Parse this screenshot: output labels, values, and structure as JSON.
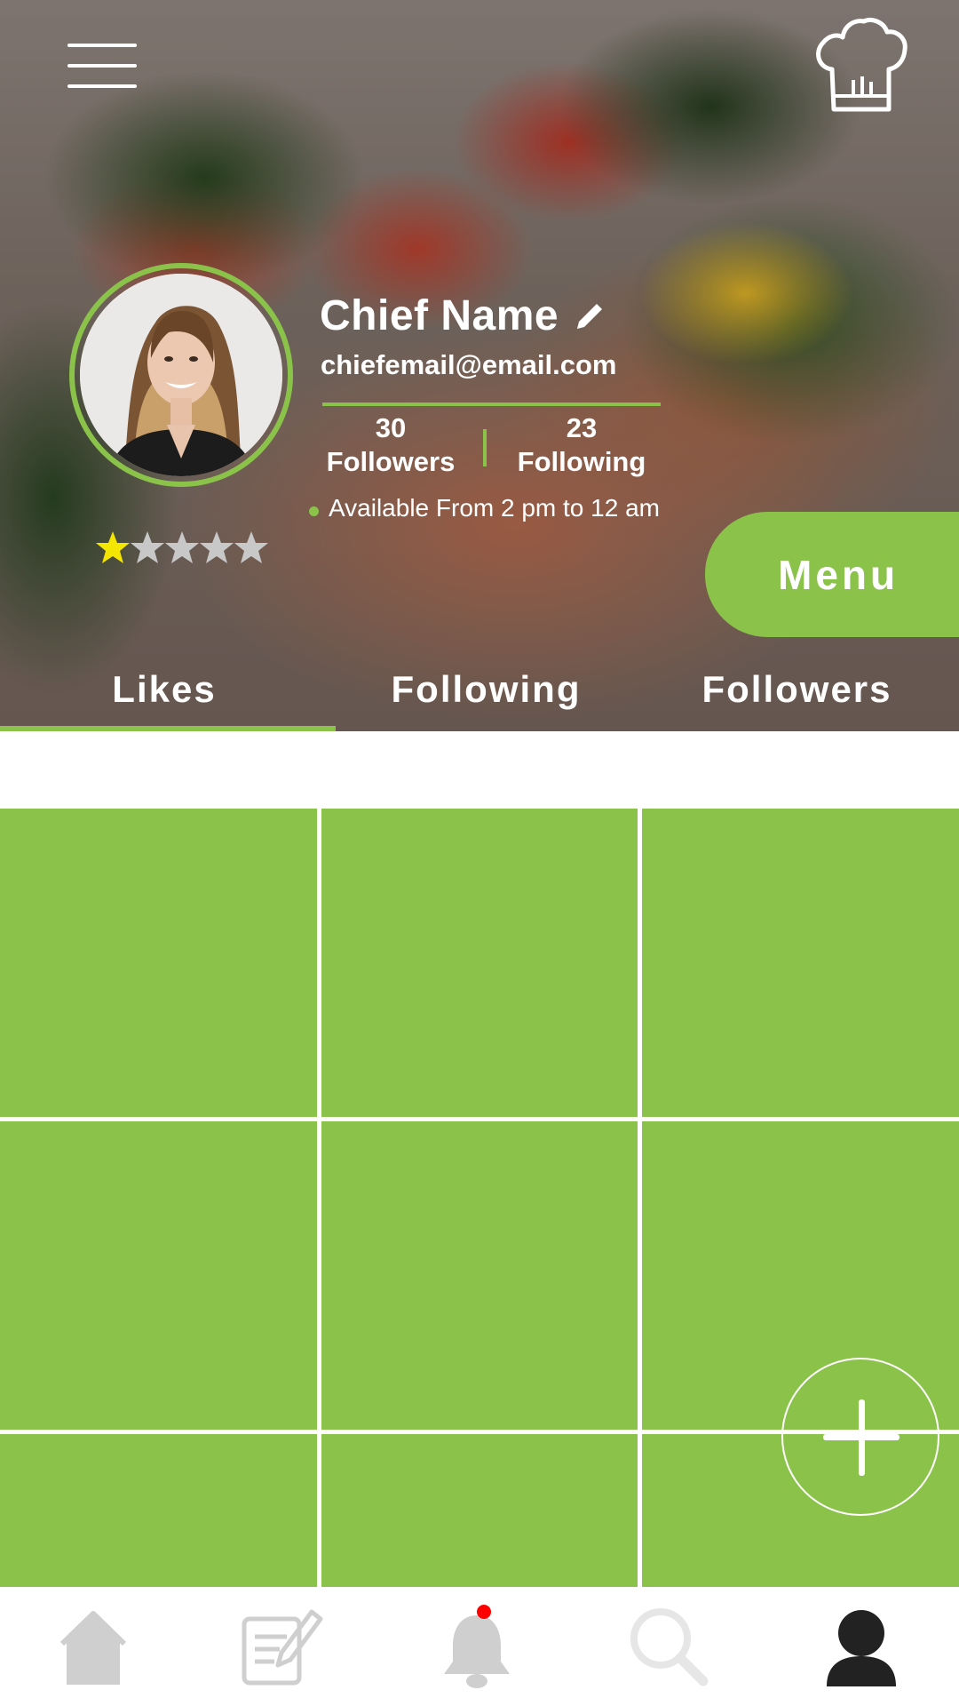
{
  "header": {
    "background": "blurred photo of grilled salmon with salad",
    "menu_icon": "hamburger-menu-icon",
    "logo_icon": "chef-hat-icon"
  },
  "profile": {
    "name": "Chief Name",
    "edit_icon": "pencil-icon",
    "email": "chiefemail@email.com",
    "followers_count": "30",
    "followers_label": "Followers",
    "following_count": "23",
    "following_label": "Following",
    "availability": "Available From 2 pm to 12 am",
    "rating": 1,
    "rating_max": 5
  },
  "menu_button": {
    "label": "Menu"
  },
  "tabs": [
    {
      "label": "Likes",
      "active": true
    },
    {
      "label": "Following",
      "active": false
    },
    {
      "label": "Followers",
      "active": false
    }
  ],
  "fab": {
    "icon": "plus-icon"
  },
  "bottom_nav": [
    {
      "icon": "home-icon",
      "active": false
    },
    {
      "icon": "edit-document-icon",
      "active": false
    },
    {
      "icon": "bell-icon",
      "active": false,
      "notification_dot": true
    },
    {
      "icon": "search-icon",
      "active": false
    },
    {
      "icon": "profile-icon",
      "active": true
    }
  ],
  "colors": {
    "accent": "#8bc34a",
    "star_filled": "#f5e600",
    "star_empty": "#c8c8c8",
    "nav_inactive": "#cfcfcf",
    "nav_active": "#222222",
    "notification": "#ff0000"
  }
}
